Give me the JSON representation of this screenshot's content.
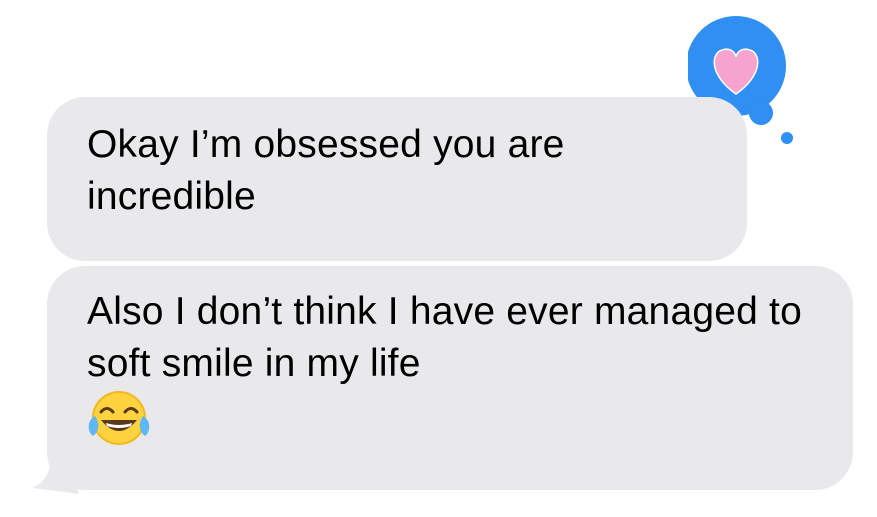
{
  "conversation": {
    "messages": [
      {
        "text": "Okay I’m obsessed you are incredible"
      },
      {
        "text": "Also I don’t think I have ever managed to soft smile in my life",
        "emoji": "face-with-tears-of-joy-icon"
      }
    ],
    "reaction": {
      "icon": "heart-icon",
      "color": "#2f8ff2",
      "heart_color": "#f7a3cf"
    }
  }
}
